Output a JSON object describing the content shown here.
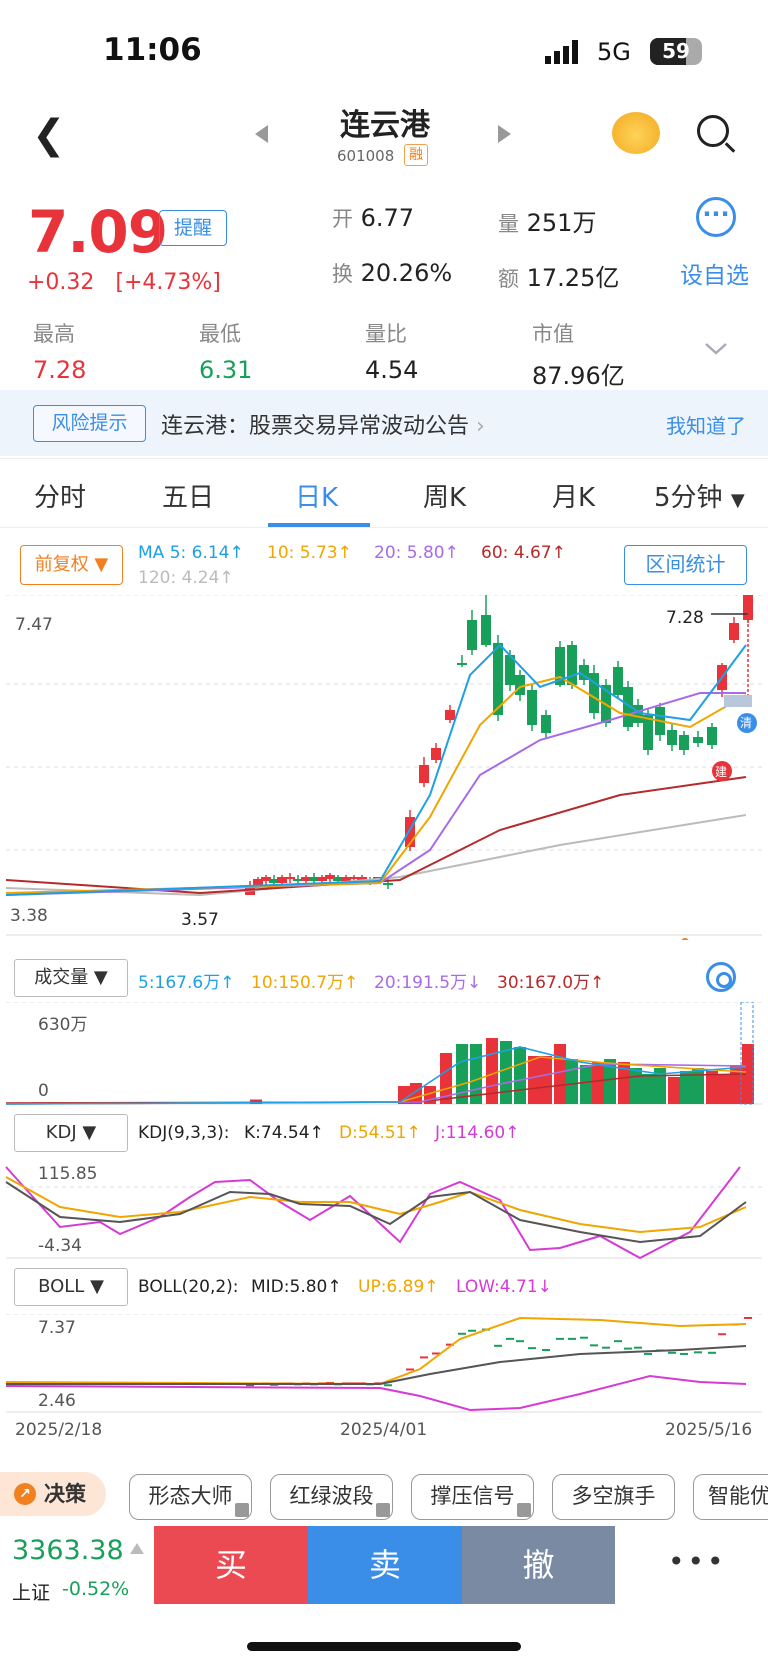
{
  "status": {
    "time": "11:06",
    "network": "5G",
    "battery": "59"
  },
  "header": {
    "title": "连云港",
    "code": "601008",
    "tag": "融"
  },
  "quote": {
    "price": "7.09",
    "remind": "提醒",
    "change": "+0.32",
    "change_pct": "[+4.73%]",
    "open_label": "开",
    "open": "6.77",
    "volume_label": "量",
    "volume": "251万",
    "turnover_label": "换",
    "turnover": "20.26%",
    "amount_label": "额",
    "amount": "17.25亿",
    "add_self": "设自选",
    "high_label": "最高",
    "high": "7.28",
    "low_label": "最低",
    "low": "6.31",
    "ratio_label": "量比",
    "ratio": "4.54",
    "mcap_label": "市值",
    "mcap": "87.96亿"
  },
  "risk": {
    "button": "风险提示",
    "text": "连云港：股票交易异常波动公告",
    "ack": "我知道了"
  },
  "tabs": [
    "分时",
    "五日",
    "日K",
    "周K",
    "月K",
    "5分钟"
  ],
  "active_tab": "日K",
  "kline": {
    "adjust": "前复权",
    "range_stats": "区间统计",
    "ma5": "MA 5: 6.14↑",
    "ma10": "10: 5.73↑",
    "ma20": "20: 5.80↑",
    "ma60": "60: 4.67↑",
    "ma120": "120: 4.24↑",
    "ymax": "7.47",
    "ymin": "3.38",
    "high_mark": "7.28",
    "low_mark": "3.57",
    "tag_qing": "清",
    "tag_jian": "建"
  },
  "volume": {
    "button": "成交量",
    "v5": "5:167.6万↑",
    "v10": "10:150.7万↑",
    "v20": "20:191.5万↓",
    "v30": "30:167.0万↑",
    "ymax": "630万",
    "ymin": "0"
  },
  "kdj": {
    "button": "KDJ",
    "params": "KDJ(9,3,3):",
    "k": "K:74.54↑",
    "d": "D:54.51↑",
    "j": "J:114.60↑",
    "ymax": "115.85",
    "ymin": "-4.34"
  },
  "boll": {
    "button": "BOLL",
    "params": "BOLL(20,2):",
    "mid": "MID:5.80↑",
    "up": "UP:6.89↑",
    "low": "LOW:4.71↓",
    "ymax": "7.37",
    "ymin": "2.46"
  },
  "dates": [
    "2025/2/18",
    "2025/4/01",
    "2025/5/16"
  ],
  "tools": {
    "decision": "决策",
    "items": [
      "形态大师",
      "红绿波段",
      "撑压信号",
      "多空旗手",
      "智能优"
    ]
  },
  "index": {
    "value": "3363.38",
    "name": "上证",
    "pct": "-0.52%"
  },
  "actions": {
    "buy": "买",
    "sell": "卖",
    "cancel": "撤"
  },
  "colors": {
    "up": "#e8333a",
    "down": "#18a05a",
    "accent": "#3a8ee8",
    "ma5": "#1fa0e6",
    "ma10": "#f0a500",
    "ma20": "#a86be8",
    "ma60": "#b52a2a",
    "ma120": "#bbbbbb"
  }
}
